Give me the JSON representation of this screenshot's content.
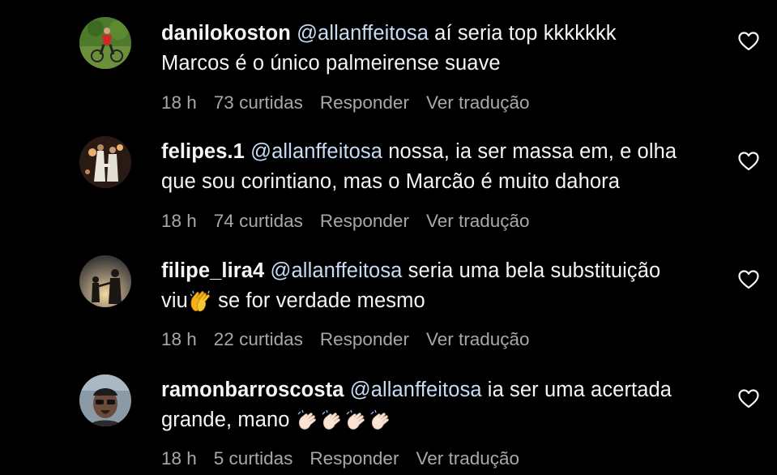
{
  "colors": {
    "background": "#000000",
    "text": "#f5f5f5",
    "mention": "#c7dcf5",
    "meta": "#a8a8a8"
  },
  "comments": [
    {
      "username": "danilokoston",
      "mention": "@allanffeitosa",
      "text_line1": " aí seria top kkkkkkk",
      "text_line2": "Marcos é o único palmeirense suave",
      "time": "18 h",
      "likes": "73 curtidas",
      "reply": "Responder",
      "translate": "Ver tradução",
      "like_icon": "heart-outline-icon"
    },
    {
      "username": "felipes.1",
      "mention": "@allanffeitosa",
      "text_line1": " nossa, ia ser massa em, e olha",
      "text_line2": "que sou corintiano, mas o Marcão é muito dahora",
      "time": "18 h",
      "likes": "74 curtidas",
      "reply": "Responder",
      "translate": "Ver tradução",
      "like_icon": "heart-outline-icon"
    },
    {
      "username": "filipe_lira4",
      "mention": "@allanffeitosa",
      "text_line1": " seria uma bela substituição",
      "text_line2a": "viu",
      "text_line2b": " se for verdade mesmo",
      "emoji_icon": "clapping-hands-emoji",
      "time": "18 h",
      "likes": "22 curtidas",
      "reply": "Responder",
      "translate": "Ver tradução",
      "like_icon": "heart-outline-icon"
    },
    {
      "username": "ramonbarroscosta",
      "mention": "@allanffeitosa",
      "text_line1": " ia ser uma acertada",
      "text_line2": "grande, mano",
      "emoji_icon": "waving-hand-emoji",
      "time": "18 h",
      "likes": "5 curtidas",
      "reply": "Responder",
      "translate": "Ver tradução",
      "like_icon": "heart-outline-icon"
    }
  ]
}
